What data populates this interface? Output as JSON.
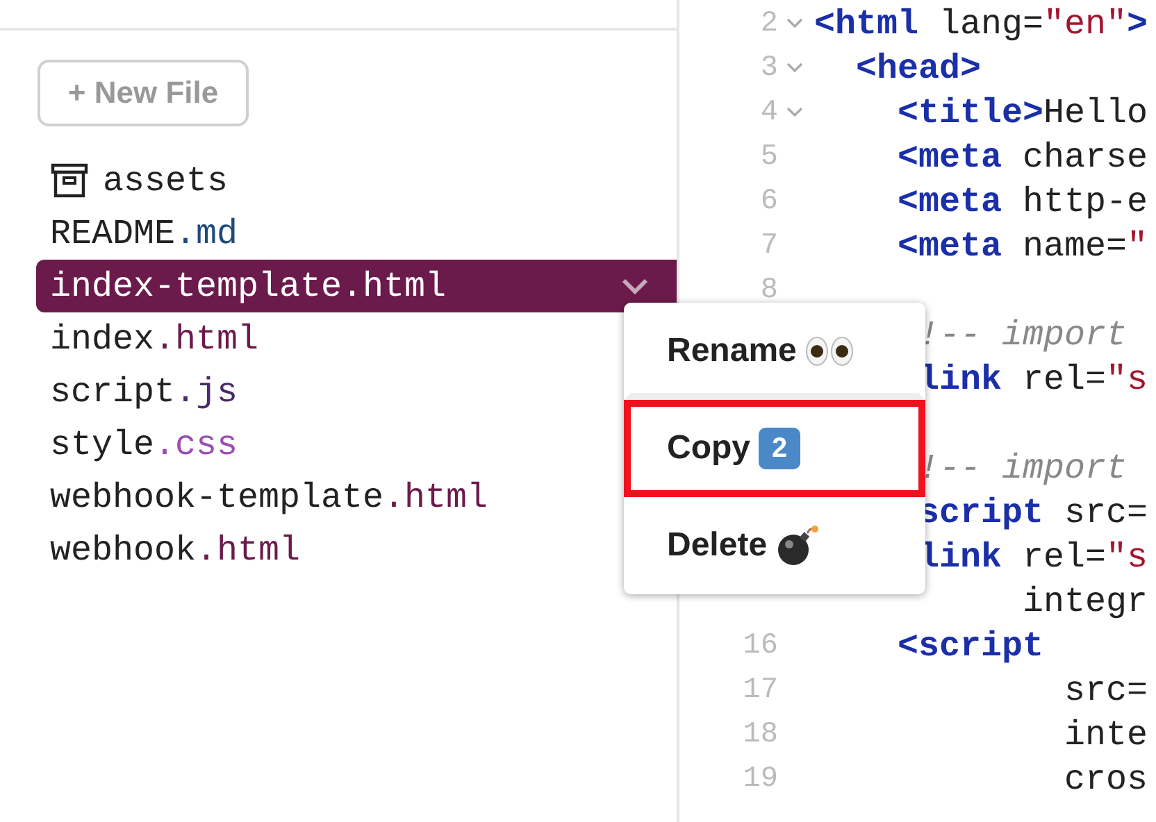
{
  "sidebar": {
    "new_file_button": "+ New File",
    "files": [
      {
        "kind": "folder",
        "name": "assets",
        "selected": false
      },
      {
        "kind": "file",
        "name": "README",
        "ext": ".md",
        "color": "#1f4a7c",
        "selected": false
      },
      {
        "kind": "file",
        "name": "index-template",
        "ext": ".html",
        "color": "#6b1b4b",
        "selected": true
      },
      {
        "kind": "file",
        "name": "index",
        "ext": ".html",
        "color": "#6b1b4b",
        "selected": false
      },
      {
        "kind": "file",
        "name": "script",
        "ext": ".js",
        "color": "#4a2a6a",
        "selected": false
      },
      {
        "kind": "file",
        "name": "style",
        "ext": ".css",
        "color": "#9a4fb0",
        "selected": false
      },
      {
        "kind": "file",
        "name": "webhook-template",
        "ext": ".html",
        "color": "#6b1b4b",
        "selected": false
      },
      {
        "kind": "file",
        "name": "webhook",
        "ext": ".html",
        "color": "#6b1b4b",
        "selected": false
      }
    ]
  },
  "context_menu": [
    {
      "kind": "rename",
      "label": "Rename",
      "highlighted": false
    },
    {
      "kind": "copy",
      "label": "Copy",
      "badge": "2",
      "highlighted": true
    },
    {
      "kind": "delete",
      "label": "Delete",
      "highlighted": false
    }
  ],
  "editor": {
    "lines": [
      {
        "number": "2",
        "foldable": true,
        "tokens": [
          {
            "kind": "tag",
            "text": "<html"
          },
          {
            "kind": "text",
            "text": " lang="
          },
          {
            "kind": "string",
            "text": "\"en\""
          },
          {
            "kind": "tag",
            "text": ">"
          }
        ]
      },
      {
        "number": "3",
        "foldable": true,
        "tokens": [
          {
            "kind": "tag",
            "text": "  <head>"
          }
        ]
      },
      {
        "number": "4",
        "foldable": true,
        "tokens": [
          {
            "kind": "tag",
            "text": "    <title>"
          },
          {
            "kind": "text",
            "text": "Hello"
          }
        ]
      },
      {
        "number": "5",
        "foldable": false,
        "tokens": [
          {
            "kind": "tag",
            "text": "    <meta"
          },
          {
            "kind": "text",
            "text": " charse"
          }
        ]
      },
      {
        "number": "6",
        "foldable": false,
        "tokens": [
          {
            "kind": "tag",
            "text": "    <meta"
          },
          {
            "kind": "text",
            "text": " http-e"
          }
        ]
      },
      {
        "number": "7",
        "foldable": false,
        "tokens": [
          {
            "kind": "tag",
            "text": "    <meta"
          },
          {
            "kind": "text",
            "text": " name="
          },
          {
            "kind": "string",
            "text": "\""
          }
        ]
      },
      {
        "number": "8",
        "foldable": false
      },
      {
        "tokens": [
          {
            "kind": "comment",
            "text": "     !-- import"
          }
        ]
      },
      {
        "tokens": [
          {
            "kind": "tag",
            "text": "     link"
          },
          {
            "kind": "text",
            "text": " rel="
          },
          {
            "kind": "string",
            "text": "\"s"
          }
        ]
      },
      {
        "gap_before": true,
        "tokens": [
          {
            "kind": "comment",
            "text": "     !-- import"
          }
        ]
      },
      {
        "tokens": [
          {
            "kind": "tag",
            "text": "     script"
          },
          {
            "kind": "text",
            "text": " src="
          }
        ]
      },
      {
        "tokens": [
          {
            "kind": "tag",
            "text": "     link"
          },
          {
            "kind": "text",
            "text": " rel="
          },
          {
            "kind": "string",
            "text": "\"s"
          }
        ]
      },
      {
        "foldable": false,
        "tokens": [
          {
            "kind": "text",
            "text": "          integr"
          }
        ]
      },
      {
        "number": "16",
        "foldable": false,
        "tokens": [
          {
            "kind": "tag",
            "text": "    <script"
          }
        ]
      },
      {
        "number": "17",
        "foldable": false,
        "tokens": [
          {
            "kind": "text",
            "text": "            src="
          }
        ]
      },
      {
        "number": "18",
        "foldable": false,
        "tokens": [
          {
            "kind": "text",
            "text": "            inte"
          }
        ]
      },
      {
        "number": "19",
        "foldable": false,
        "tokens": [
          {
            "kind": "text",
            "text": "            cros"
          }
        ]
      }
    ]
  }
}
